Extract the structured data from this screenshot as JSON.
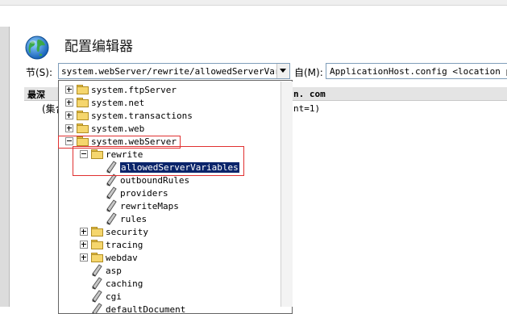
{
  "window": {
    "title": "配置编辑器"
  },
  "section": {
    "label": "节(S):",
    "value": "system.webServer/rewrite/allowedServerVariabl"
  },
  "from": {
    "label": "自(M):",
    "value": "ApplicationHost.config <location path"
  },
  "background": {
    "header_text": "最深",
    "header_fragment": "n. com",
    "row2_text": "(集合",
    "row2_fragment": "nt=1)"
  },
  "tree": [
    {
      "label": "system.ftpServer",
      "depth": 0,
      "kind": "folder",
      "expander": "plus"
    },
    {
      "label": "system.net",
      "depth": 0,
      "kind": "folder",
      "expander": "plus"
    },
    {
      "label": "system.transactions",
      "depth": 0,
      "kind": "folder",
      "expander": "plus"
    },
    {
      "label": "system.web",
      "depth": 0,
      "kind": "folder",
      "expander": "plus"
    },
    {
      "label": "system.webServer",
      "depth": 0,
      "kind": "folder",
      "expander": "minus"
    },
    {
      "label": "rewrite",
      "depth": 1,
      "kind": "folder",
      "expander": "minus"
    },
    {
      "label": "allowedServerVariables",
      "depth": 2,
      "kind": "section",
      "selected": true
    },
    {
      "label": "outboundRules",
      "depth": 2,
      "kind": "section"
    },
    {
      "label": "providers",
      "depth": 2,
      "kind": "section"
    },
    {
      "label": "rewriteMaps",
      "depth": 2,
      "kind": "section"
    },
    {
      "label": "rules",
      "depth": 2,
      "kind": "section"
    },
    {
      "label": "security",
      "depth": 1,
      "kind": "folder",
      "expander": "plus"
    },
    {
      "label": "tracing",
      "depth": 1,
      "kind": "folder",
      "expander": "plus"
    },
    {
      "label": "webdav",
      "depth": 1,
      "kind": "folder",
      "expander": "plus"
    },
    {
      "label": "asp",
      "depth": 1,
      "kind": "section"
    },
    {
      "label": "caching",
      "depth": 1,
      "kind": "section"
    },
    {
      "label": "cgi",
      "depth": 1,
      "kind": "section"
    },
    {
      "label": "defaultDocument",
      "depth": 1,
      "kind": "section"
    }
  ],
  "icons": {
    "title": "globe-icon",
    "folder": "folder-icon",
    "section": "pen-icon",
    "dropdown": "chevron-down-icon"
  },
  "colors": {
    "selection": "#0a246a",
    "highlight_box": "#e03030",
    "folder": "#f5d66d"
  }
}
